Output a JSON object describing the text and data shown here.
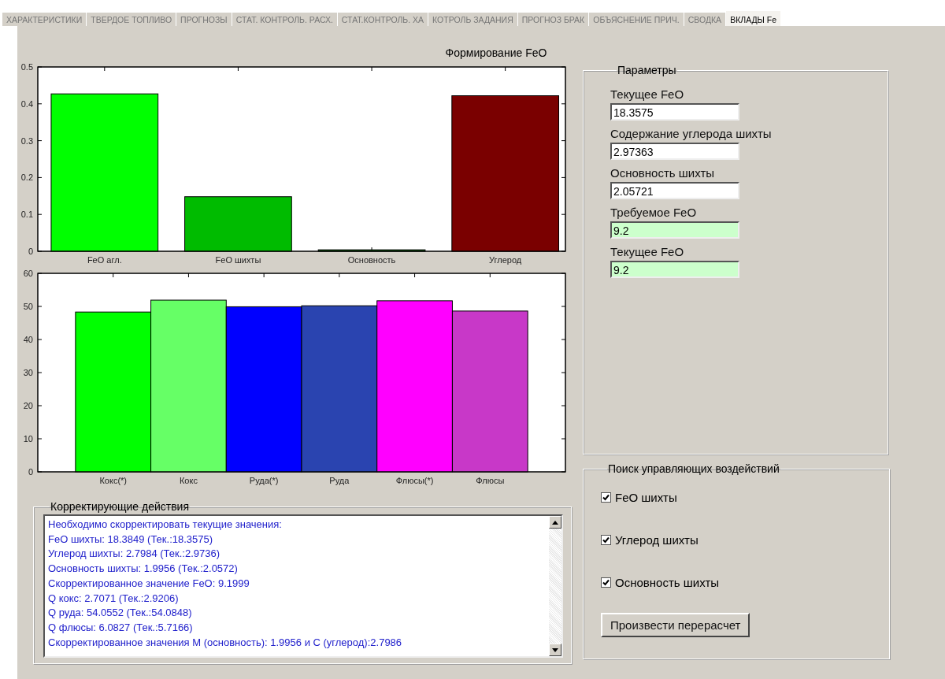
{
  "tabs": [
    {
      "label": "ХАРАКТЕРИСТИКИ",
      "selected": false
    },
    {
      "label": "ТВЕРДОЕ ТОПЛИВО",
      "selected": false
    },
    {
      "label": "ПРОГНОЗЫ",
      "selected": false
    },
    {
      "label": "СТАТ. КОНТРОЛЬ. РАСХ.",
      "selected": false
    },
    {
      "label": "СТАТ.КОНТРОЛЬ. ХА",
      "selected": false
    },
    {
      "label": "КОТРОЛЬ ЗАДАНИЯ",
      "selected": false
    },
    {
      "label": "ПРОГНОЗ БРАК",
      "selected": false
    },
    {
      "label": "ОБЪЯСНЕНИЕ ПРИЧ.",
      "selected": false
    },
    {
      "label": "СВОДКА",
      "selected": false
    },
    {
      "label": "ВКЛАДЫ Fe",
      "selected": true
    }
  ],
  "title": "Формирование FeO",
  "charts": [
    {
      "chart_data": {
        "type": "bar",
        "categories": [
          "FeO агл.",
          "FeO шихты",
          "Основность",
          "Углерод"
        ],
        "values": [
          0.427,
          0.148,
          0.004,
          0.422
        ],
        "ylim": [
          0,
          0.5
        ],
        "yticks": [
          0,
          0.1,
          0.2,
          0.3,
          0.4,
          0.5
        ]
      }
    },
    {
      "chart_data": {
        "type": "bar",
        "categories": [
          "Кокс(*)",
          "Кокс",
          "Руда(*)",
          "Руда",
          "Флюсы(*)",
          "Флюсы"
        ],
        "values": [
          48.3,
          51.9,
          49.9,
          50.2,
          51.7,
          48.6
        ],
        "ylim": [
          0,
          60
        ],
        "yticks": [
          0,
          10,
          20,
          30,
          40,
          50,
          60
        ]
      }
    }
  ],
  "corrective": {
    "title": "Корректирующие действия",
    "lines": [
      "Необходимо скорректировать текущие значения:",
      "FeO шихты: 18.3849 (Тек.:18.3575)",
      "Углерод шихты: 2.7984 (Тек.:2.9736)",
      "Основность шихты: 1.9956 (Тек.:2.0572)",
      "Скорректированное значение FeO: 9.1999",
      "Q кокс: 2.7071 (Тек.:2.9206)",
      "Q руда: 54.0552 (Тек.:54.0848)",
      "Q флюсы: 6.0827 (Тек.:5.7166)",
      "Скорректированное значения M (основность): 1.9956 и C (углерод):2.7986"
    ]
  },
  "parameters": {
    "title": "Параметры",
    "fields": [
      {
        "label": "Текущее FeO",
        "value": "18.3575",
        "kind": "input"
      },
      {
        "label": "Содержание углерода шихты",
        "value": "2.97363",
        "kind": "input"
      },
      {
        "label": "Основность шихты",
        "value": "2.05721",
        "kind": "input"
      },
      {
        "label": "Требуемое FeO",
        "value": "9.2",
        "kind": "result"
      },
      {
        "label": "Текущее FeO",
        "value": "9.2",
        "kind": "result"
      }
    ]
  },
  "search": {
    "title": "Поиск управляющих воздействий",
    "options": [
      {
        "label": "FeO шихты",
        "checked": true
      },
      {
        "label": "Углерод шихты",
        "checked": true
      },
      {
        "label": "Основность шихты",
        "checked": true
      }
    ],
    "button": "Произвести перерасчет"
  }
}
